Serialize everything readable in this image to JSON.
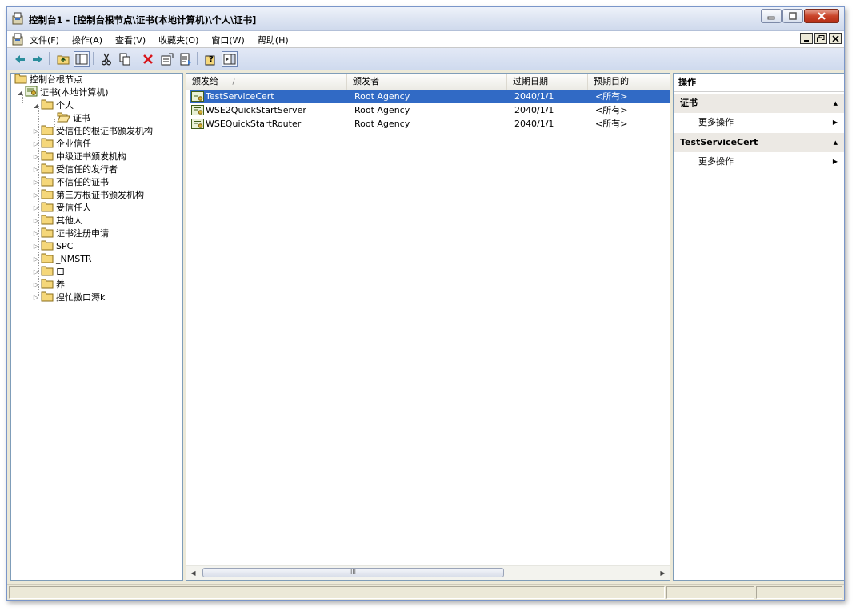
{
  "window": {
    "title": "控制台1 - [控制台根节点\\证书(本地计算机)\\个人\\证书]"
  },
  "menu": [
    "文件(F)",
    "操作(A)",
    "查看(V)",
    "收藏夹(O)",
    "窗口(W)",
    "帮助(H)"
  ],
  "tree": [
    {
      "label": "控制台根节点"
    },
    {
      "label": "证书(本地计算机)"
    },
    {
      "label": "个人"
    },
    {
      "label": "证书"
    },
    {
      "label": "受信任的根证书颁发机构"
    },
    {
      "label": "企业信任"
    },
    {
      "label": "中级证书颁发机构"
    },
    {
      "label": "受信任的发行者"
    },
    {
      "label": "不信任的证书"
    },
    {
      "label": "第三方根证书颁发机构"
    },
    {
      "label": "受信任人"
    },
    {
      "label": "其他人"
    },
    {
      "label": "证书注册申请"
    },
    {
      "label": "SPC"
    },
    {
      "label": "_NMSTR"
    },
    {
      "label": "口"
    },
    {
      "label": "养"
    },
    {
      "label": "揑忙撽口溽k"
    }
  ],
  "list": {
    "sort_indicator": "/",
    "columns": [
      "颁发给",
      "颁发者",
      "过期日期",
      "预期目的"
    ],
    "rows": [
      {
        "issued_to": "TestServiceCert",
        "issued_by": "Root Agency",
        "expires": "2040/1/1",
        "purpose": "<所有>"
      },
      {
        "issued_to": "WSE2QuickStartServer",
        "issued_by": "Root Agency",
        "expires": "2040/1/1",
        "purpose": "<所有>"
      },
      {
        "issued_to": "WSEQuickStartRouter",
        "issued_by": "Root Agency",
        "expires": "2040/1/1",
        "purpose": "<所有>"
      }
    ],
    "selected_row": 0,
    "scroll_grip": "III"
  },
  "actions": {
    "header": "操作",
    "sections": [
      {
        "title": "证书",
        "items": [
          "更多操作"
        ]
      },
      {
        "title": "TestServiceCert",
        "items": [
          "更多操作"
        ]
      }
    ]
  },
  "colors": {
    "selection": "#316ac5",
    "folder": "#f5d77a",
    "close_button": "#c9442a",
    "nav_arrow": "#2a8d9c"
  }
}
